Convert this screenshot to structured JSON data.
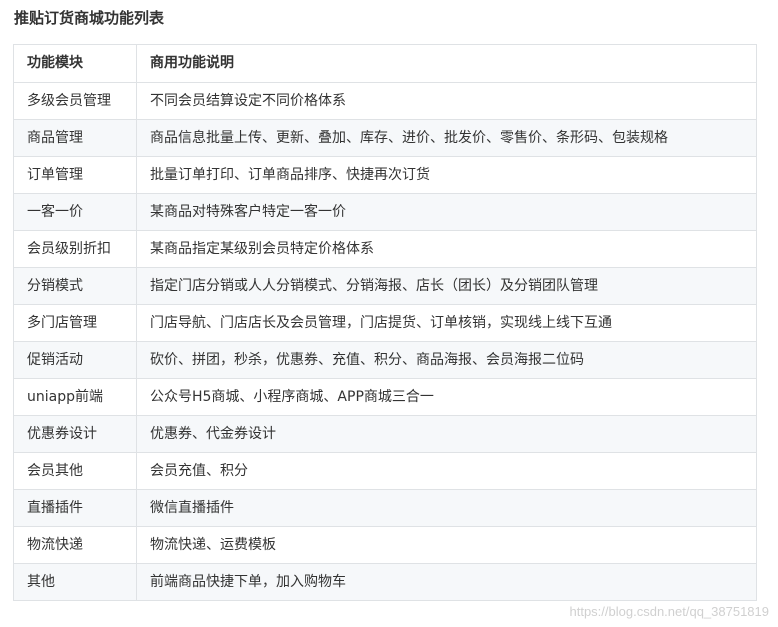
{
  "heading": "推贴订货商城功能列表",
  "table": {
    "headers": [
      "功能模块",
      "商用功能说明"
    ],
    "rows": [
      {
        "module": "多级会员管理",
        "desc": "不同会员结算设定不同价格体系"
      },
      {
        "module": "商品管理",
        "desc": "商品信息批量上传、更新、叠加、库存、进价、批发价、零售价、条形码、包装规格"
      },
      {
        "module": "订单管理",
        "desc": "批量订单打印、订单商品排序、快捷再次订货"
      },
      {
        "module": "一客一价",
        "desc": "某商品对特殊客户特定一客一价"
      },
      {
        "module": "会员级别折扣",
        "desc": "某商品指定某级别会员特定价格体系"
      },
      {
        "module": "分销模式",
        "desc": "指定门店分销或人人分销模式、分销海报、店长（团长）及分销团队管理"
      },
      {
        "module": "多门店管理",
        "desc": "门店导航、门店店长及会员管理，门店提货、订单核销，实现线上线下互通"
      },
      {
        "module": "促销活动",
        "desc": "砍价、拼团，秒杀，优惠券、充值、积分、商品海报、会员海报二位码"
      },
      {
        "module": "uniapp前端",
        "desc": "公众号H5商城、小程序商城、APP商城三合一"
      },
      {
        "module": "优惠券设计",
        "desc": "优惠券、代金券设计"
      },
      {
        "module": "会员其他",
        "desc": "会员充值、积分"
      },
      {
        "module": "直播插件",
        "desc": "微信直播插件"
      },
      {
        "module": "物流快递",
        "desc": "物流快递、运费模板"
      },
      {
        "module": "其他",
        "desc": "前端商品快捷下单，加入购物车"
      }
    ]
  },
  "watermark": "https://blog.csdn.net/qq_38751819"
}
